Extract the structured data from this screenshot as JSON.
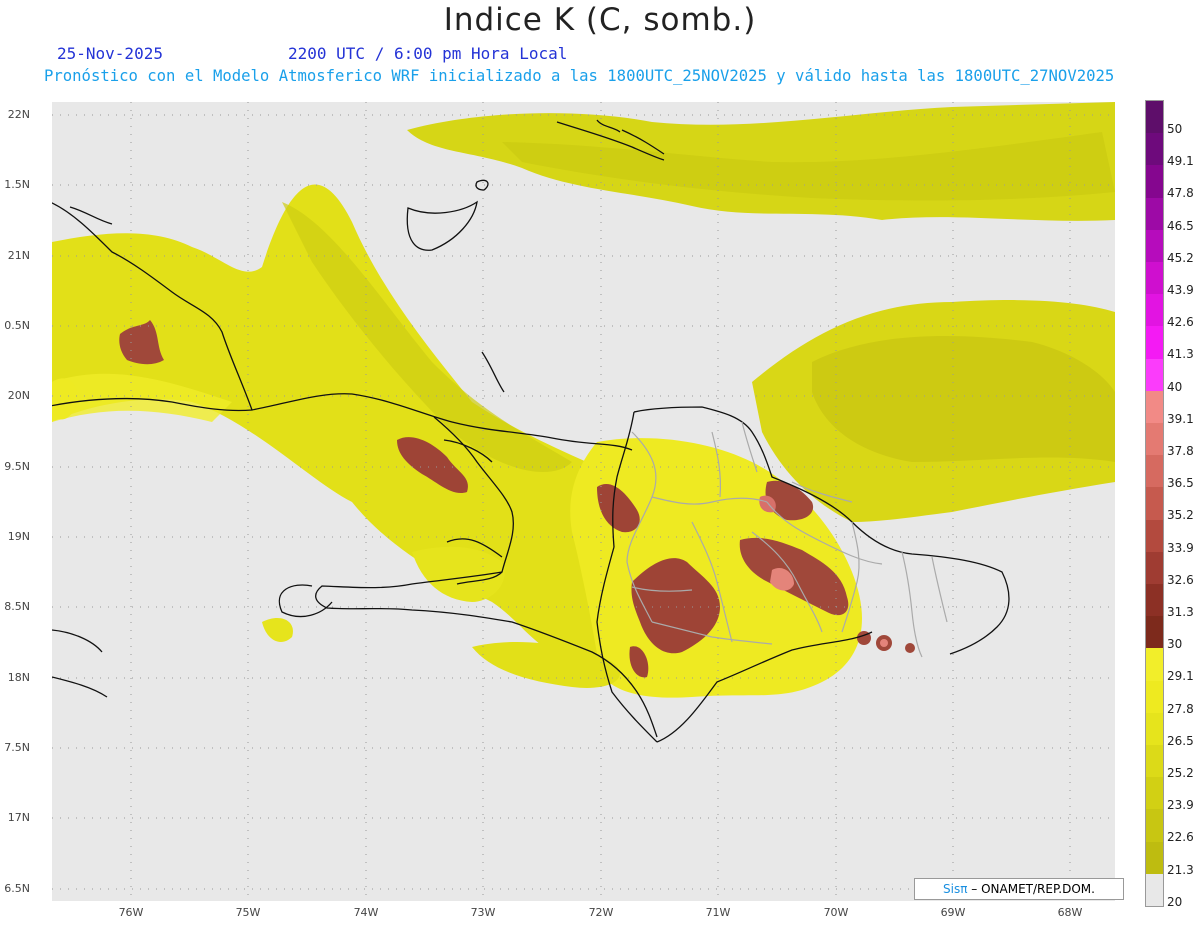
{
  "title": "Indice K (C, somb.)",
  "header": {
    "date": "25-Nov-2025",
    "time": "2200 UTC / 6:00 pm Hora Local",
    "forecast": "Pronóstico con el Modelo Atmosferico WRF inicializado a las 1800UTC_25NOV2025 y válido hasta las  1800UTC_27NOV2025"
  },
  "axes": {
    "y_ticks": [
      "22N",
      "1.5N",
      "21N",
      "0.5N",
      "20N",
      "9.5N",
      "19N",
      "8.5N",
      "18N",
      "7.5N",
      "17N",
      "6.5N"
    ],
    "x_ticks": [
      "76W",
      "75W",
      "74W",
      "73W",
      "72W",
      "71W",
      "70W",
      "69W",
      "68W"
    ]
  },
  "colorbar": {
    "labels": [
      "50",
      "49.1",
      "47.8",
      "46.5",
      "45.2",
      "43.9",
      "42.6",
      "41.3",
      "40",
      "39.1",
      "37.8",
      "36.5",
      "35.2",
      "33.9",
      "32.6",
      "31.3",
      "30",
      "29.1",
      "27.8",
      "26.5",
      "25.2",
      "23.9",
      "22.6",
      "21.3",
      "20"
    ],
    "colors": [
      "#5e0e6a",
      "#6e0a7c",
      "#85068f",
      "#9d0aa6",
      "#b60cbc",
      "#cf0fcf",
      "#e214e2",
      "#f41af4",
      "#fb3cfb",
      "#f28a86",
      "#e47a72",
      "#d66a60",
      "#c65a4e",
      "#b34a3e",
      "#9f3c32",
      "#8c3025",
      "#7d2a1c",
      "#f2ee2a",
      "#eeea20",
      "#e6e41c",
      "#dcda18",
      "#d2d014",
      "#c8c612",
      "#bebc10",
      "#e8e8e8"
    ]
  },
  "credit": {
    "sis": "Sisπ",
    "org": " – ONAMET/REP.DOM."
  }
}
